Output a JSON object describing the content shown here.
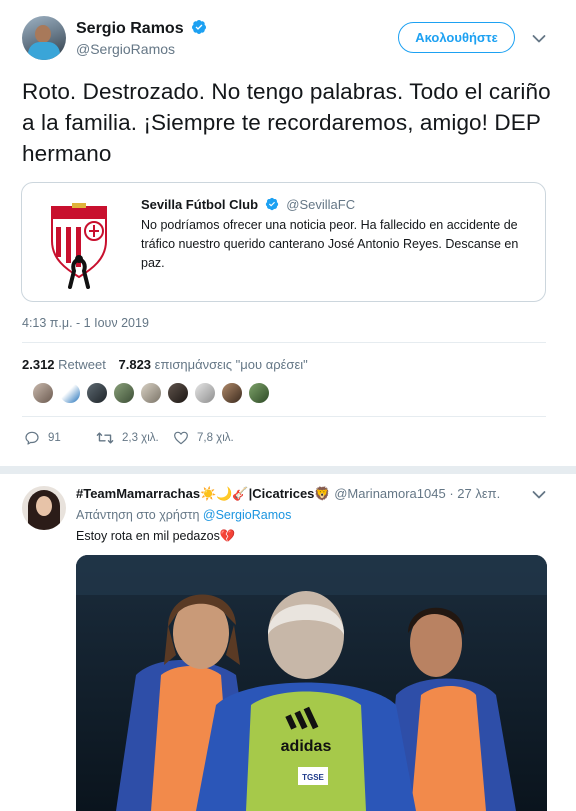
{
  "tweet": {
    "author_name": "Sergio Ramos",
    "author_handle": "@SergioRamos",
    "follow_label": "Ακολουθήστε",
    "text": "Roto. Destrozado. No tengo palabras. Todo el cariño a la familia. ¡Siempre te recordaremos, amigo! DEP hermano",
    "timestamp": "4:13 π.μ. - 1 Ιουν 2019",
    "retweet_count": "2.312",
    "retweet_label": "Retweet",
    "like_count": "7.823",
    "like_label": "επισημάνσεις \"μου αρέσει\"",
    "actions": {
      "reply_count": "91",
      "retweet_count": "2,3 χιλ.",
      "like_count": "7,8 χιλ."
    }
  },
  "quoted": {
    "name": "Sevilla Fútbol Club",
    "handle": "@SevillaFC",
    "text": "No podríamos ofrecer una noticia peor. Ha fallecido en accidente de tráfico nuestro querido canterano José Antonio Reyes. Descanse en paz."
  },
  "reply": {
    "display_name": "#TeamMamarrachas☀️🌙🎸|Cicatrices🦁",
    "handle": "@Marinamora1045",
    "time": "· 27 λεπ.",
    "replying_to_label": "Απάντηση στο χρήστη",
    "replying_to_handle": "@SergioRamos",
    "text": "Estoy rota en mil pedazos💔",
    "photo_text": {
      "brand": "adidas",
      "badge": "TGSE"
    }
  },
  "colors": {
    "accent": "#1da1f2",
    "text": "#14171a",
    "muted": "#657786",
    "border": "#e6ecf0"
  },
  "icons": [
    "verified-badge-icon",
    "chevron-down-icon",
    "reply-icon",
    "retweet-icon",
    "heart-icon"
  ]
}
